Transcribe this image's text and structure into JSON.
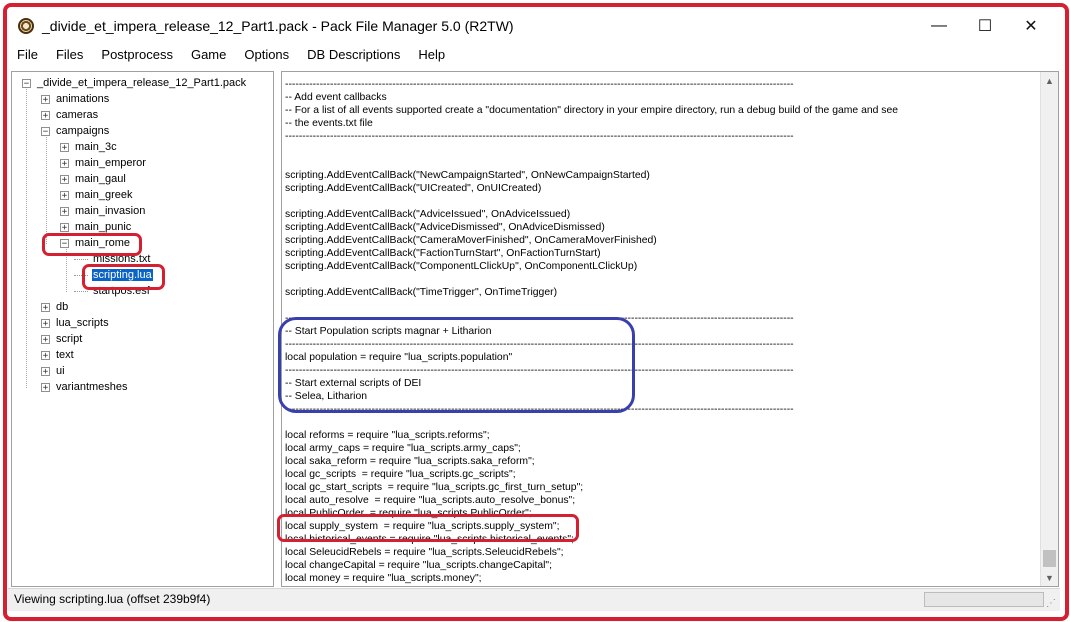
{
  "window": {
    "title": "_divide_et_impera_release_12_Part1.pack - Pack File Manager 5.0 (R2TW)",
    "controls": [
      "—",
      "☐",
      "✕"
    ]
  },
  "menu": [
    "File",
    "Files",
    "Postprocess",
    "Game",
    "Options",
    "DB Descriptions",
    "Help"
  ],
  "tree": {
    "root": "_divide_et_impera_release_12_Part1.pack",
    "folders_top": [
      "animations",
      "cameras",
      "campaigns"
    ],
    "campaigns": [
      "main_3c",
      "main_emperor",
      "main_gaul",
      "main_greek",
      "main_invasion",
      "main_punic",
      "main_rome"
    ],
    "main_rome_files": [
      "missions.txt",
      "scripting.lua",
      "startpos.esf"
    ],
    "folders_bottom": [
      "db",
      "lua_scripts",
      "script",
      "text",
      "ui",
      "variantmeshes"
    ]
  },
  "code": [
    "---------------------------------------------------------------------------------------------------------------------------------------------------",
    "-- Add event callbacks",
    "-- For a list of all events supported create a \"documentation\" directory in your empire directory, run a debug build of the game and see",
    "-- the events.txt file",
    "---------------------------------------------------------------------------------------------------------------------------------------------------",
    "",
    "",
    "scripting.AddEventCallBack(\"NewCampaignStarted\", OnNewCampaignStarted)",
    "scripting.AddEventCallBack(\"UICreated\", OnUICreated)",
    "",
    "scripting.AddEventCallBack(\"AdviceIssued\", OnAdviceIssued)",
    "scripting.AddEventCallBack(\"AdviceDismissed\", OnAdviceDismissed)",
    "scripting.AddEventCallBack(\"CameraMoverFinished\", OnCameraMoverFinished)",
    "scripting.AddEventCallBack(\"FactionTurnStart\", OnFactionTurnStart)",
    "scripting.AddEventCallBack(\"ComponentLClickUp\", OnComponentLClickUp)",
    "",
    "scripting.AddEventCallBack(\"TimeTrigger\", OnTimeTrigger)",
    "",
    "---------------------------------------------------------------------------------------------------------------------------------------------------",
    "-- Start Population scripts magnar + Litharion",
    "---------------------------------------------------------------------------------------------------------------------------------------------------",
    "local population = require \"lua_scripts.population\"",
    "---------------------------------------------------------------------------------------------------------------------------------------------------",
    "-- Start external scripts of DEI",
    "-- Selea, Litharion",
    "---------------------------------------------------------------------------------------------------------------------------------------------------",
    "",
    "local reforms = require \"lua_scripts.reforms\";",
    "local army_caps = require \"lua_scripts.army_caps\";",
    "local saka_reform = require \"lua_scripts.saka_reform\";",
    "local gc_scripts  = require \"lua_scripts.gc_scripts\";",
    "local gc_start_scripts  = require \"lua_scripts.gc_first_turn_setup\";",
    "local auto_resolve  = require \"lua_scripts.auto_resolve_bonus\";",
    "local PublicOrder  = require \"lua_scripts.PublicOrder\";",
    "local supply_system  = require \"lua_scripts.supply_system\";",
    "local historical_events = require \"lua_scripts.historical_events\";",
    "local SeleucidRebels = require \"lua_scripts.SeleucidRebels\";",
    "local changeCapital = require \"lua_scripts.changeCapital\";",
    "local money = require \"lua_scripts.money\";"
  ],
  "status": {
    "text": "Viewing scripting.lua (offset 239b9f4)"
  },
  "colors": {
    "annotation_red": "#d42031",
    "annotation_blue": "#3a3fae",
    "selection": "#0a64c8"
  }
}
